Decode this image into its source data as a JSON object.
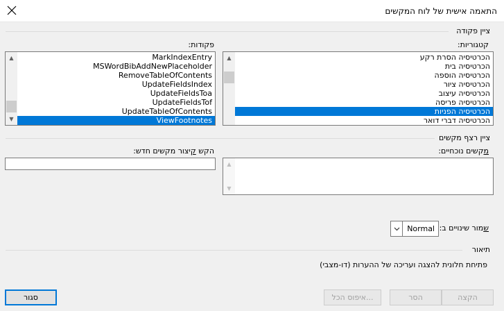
{
  "window": {
    "title": "התאמה אישית של לוח המקשים"
  },
  "command_group": {
    "label": "ציין פקודה",
    "categories_label": "קטגוריות:",
    "categories": [
      "הכרטיסיה הסרת רקע",
      "הכרטיסיה בית",
      "הכרטיסיה הוספה",
      "הכרטיסיה ציור",
      "הכרטיסיה עיצוב",
      "הכרטיסיה פריסה",
      "הכרטיסיה הפניות",
      "הכרטיסיה דברי דואר"
    ],
    "categories_selected_index": 6,
    "commands_label": "פקודות:",
    "commands": [
      "MarkIndexEntry",
      "MSWordBibAddNewPlaceholder",
      "RemoveTableOfContents",
      "UpdateFieldsIndex",
      "UpdateFieldsToa",
      "UpdateFieldsTof",
      "UpdateTableOfContents",
      "ViewFootnotes"
    ],
    "commands_selected_index": 7
  },
  "keys_group": {
    "label": "ציין רצף מקשים",
    "current_keys_label": "מקשים נוכחיים:",
    "new_shortcut_label": "הקש קיצור מקשים חדש:",
    "new_shortcut_value": ""
  },
  "save_in": {
    "label": "שמור שינויים ב:",
    "value": "Normal"
  },
  "description": {
    "label": "תיאור",
    "text": "פתיחת חלונית להצגה ועריכה של ההערות (דו-מצבי)"
  },
  "buttons": {
    "assign": "הקצה",
    "remove": "הסר",
    "reset_all": "איפוס הכל...",
    "close": "סגור"
  },
  "icons": {
    "close": "close-icon",
    "scroll_up": "chevron-up-icon",
    "scroll_down": "chevron-down-icon",
    "dropdown": "chevron-down-icon"
  }
}
